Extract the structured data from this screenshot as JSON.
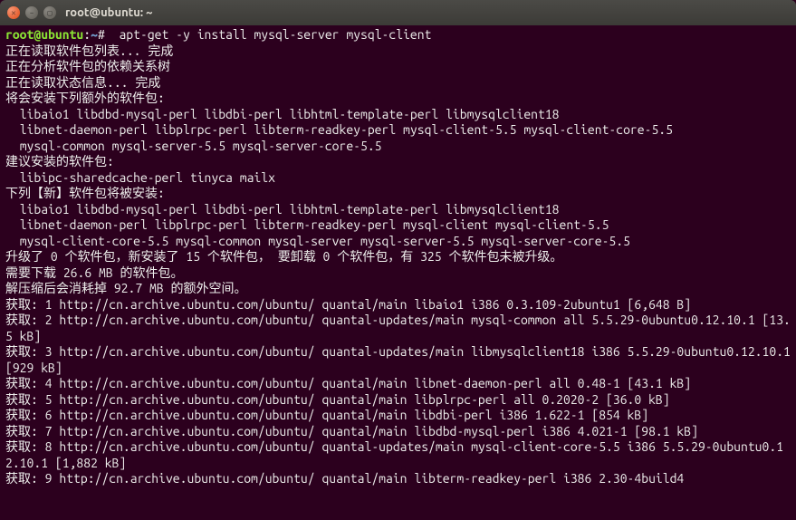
{
  "window": {
    "title": "root@ubuntu: ~"
  },
  "prompt": {
    "user_host": "root@ubuntu",
    "sep": ":",
    "path": "~",
    "symbol": "#",
    "command": "  apt-get -y install mysql-server mysql-client"
  },
  "lines": [
    "正在读取软件包列表... 完成",
    "正在分析软件包的依赖关系树",
    "正在读取状态信息... 完成",
    "将会安装下列额外的软件包:",
    "  libaio1 libdbd-mysql-perl libdbi-perl libhtml-template-perl libmysqlclient18",
    "  libnet-daemon-perl libplrpc-perl libterm-readkey-perl mysql-client-5.5 mysql-client-core-5.5",
    "  mysql-common mysql-server-5.5 mysql-server-core-5.5",
    "建议安装的软件包:",
    "  libipc-sharedcache-perl tinyca mailx",
    "下列【新】软件包将被安装:",
    "  libaio1 libdbd-mysql-perl libdbi-perl libhtml-template-perl libmysqlclient18",
    "  libnet-daemon-perl libplrpc-perl libterm-readkey-perl mysql-client mysql-client-5.5",
    "  mysql-client-core-5.5 mysql-common mysql-server mysql-server-5.5 mysql-server-core-5.5",
    "升级了 0 个软件包，新安装了 15 个软件包， 要卸载 0 个软件包，有 325 个软件包未被升级。",
    "需要下载 26.6 MB 的软件包。",
    "解压缩后会消耗掉 92.7 MB 的额外空间。",
    "获取: 1 http://cn.archive.ubuntu.com/ubuntu/ quantal/main libaio1 i386 0.3.109-2ubuntu1 [6,648 B]",
    "获取: 2 http://cn.archive.ubuntu.com/ubuntu/ quantal-updates/main mysql-common all 5.5.29-0ubuntu0.12.10.1 [13.5 kB]",
    "获取: 3 http://cn.archive.ubuntu.com/ubuntu/ quantal-updates/main libmysqlclient18 i386 5.5.29-0ubuntu0.12.10.1 [929 kB]",
    "获取: 4 http://cn.archive.ubuntu.com/ubuntu/ quantal/main libnet-daemon-perl all 0.48-1 [43.1 kB]",
    "获取: 5 http://cn.archive.ubuntu.com/ubuntu/ quantal/main libplrpc-perl all 0.2020-2 [36.0 kB]",
    "获取: 6 http://cn.archive.ubuntu.com/ubuntu/ quantal/main libdbi-perl i386 1.622-1 [854 kB]",
    "获取: 7 http://cn.archive.ubuntu.com/ubuntu/ quantal/main libdbd-mysql-perl i386 4.021-1 [98.1 kB]",
    "获取: 8 http://cn.archive.ubuntu.com/ubuntu/ quantal-updates/main mysql-client-core-5.5 i386 5.5.29-0ubuntu0.12.10.1 [1,882 kB]",
    "获取: 9 http://cn.archive.ubuntu.com/ubuntu/ quantal/main libterm-readkey-perl i386 2.30-4build4"
  ]
}
